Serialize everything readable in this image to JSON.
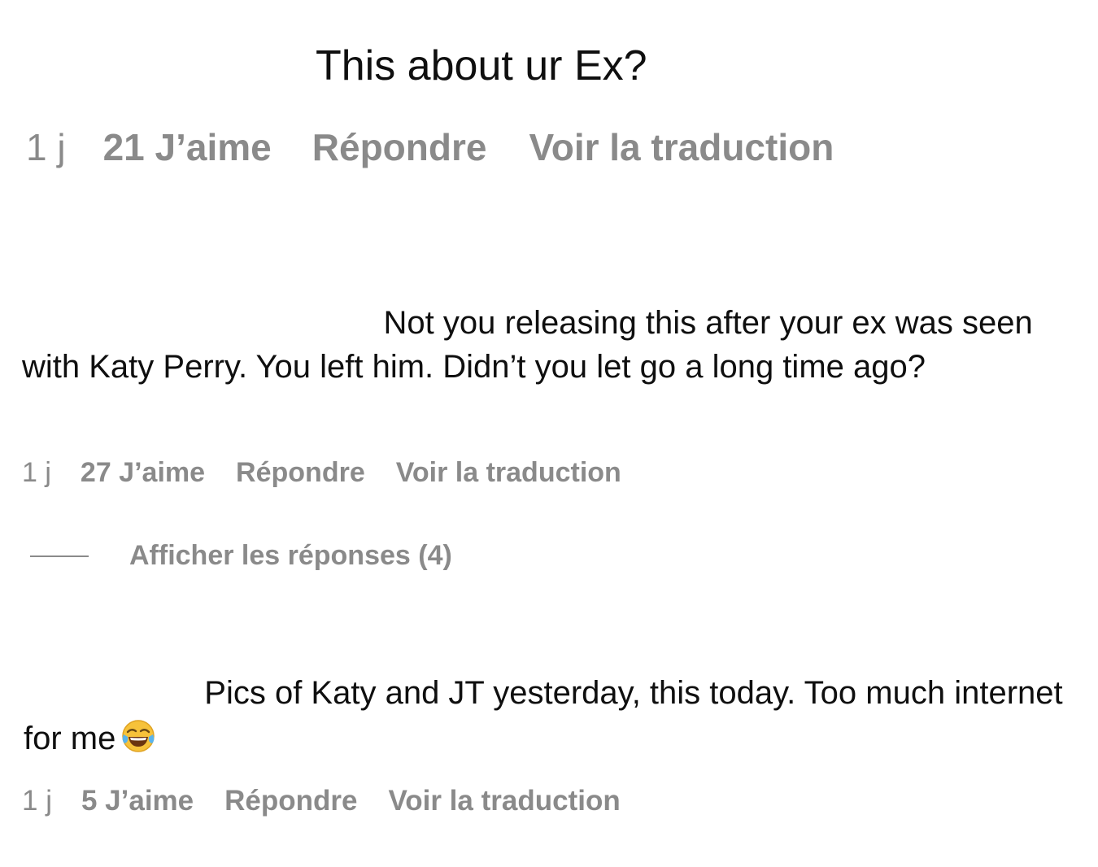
{
  "comments": [
    {
      "text": "This about ur Ex?",
      "time": "1 j",
      "likes": "21 J’aime",
      "reply": "Répondre",
      "translate": "Voir la traduction"
    },
    {
      "text": "                                        Not you releasing this after your ex was seen with Katy Perry. You left him. Didn’t you let go a long time ago?",
      "time": "1 j",
      "likes": "27 J’aime",
      "reply": "Répondre",
      "translate": "Voir la traduction"
    },
    {
      "text": "                    Pics of Katy and JT yesterday, this today. Too much internet for me",
      "emoji": "tears-of-joy-emoji",
      "time": "1 j",
      "likes": "5 J’aime",
      "reply": "Répondre",
      "translate": "Voir la traduction"
    }
  ],
  "replies_toggle": {
    "label": "Afficher les réponses (4)"
  },
  "colors": {
    "text": "#0f0f0f",
    "meta": "#8a8a8a",
    "background": "#ffffff"
  }
}
